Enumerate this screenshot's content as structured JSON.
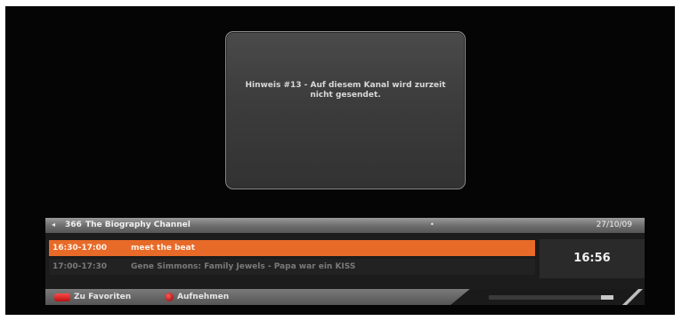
{
  "notice": {
    "text": "Hinweis #13 - Auf diesem Kanal wird zurzeit nicht gesendet."
  },
  "channel": {
    "arrow": "◂",
    "number": "366",
    "name": "The Biography Channel",
    "indicator": "•",
    "date": "27/10/09"
  },
  "programs": [
    {
      "time": "16:30-17:00",
      "title": "meet the beat"
    },
    {
      "time": "17:00-17:30",
      "title": "Gene Simmons: Family Jewels - Papa war ein KISS"
    }
  ],
  "clock": "16:56",
  "footer": {
    "favorites_label": "Zu Favoriten",
    "record_label": "Aufnehmen"
  },
  "signal": {
    "level": 0.9
  },
  "colors": {
    "highlight": "#e86a28",
    "red_key": "#d01818"
  }
}
